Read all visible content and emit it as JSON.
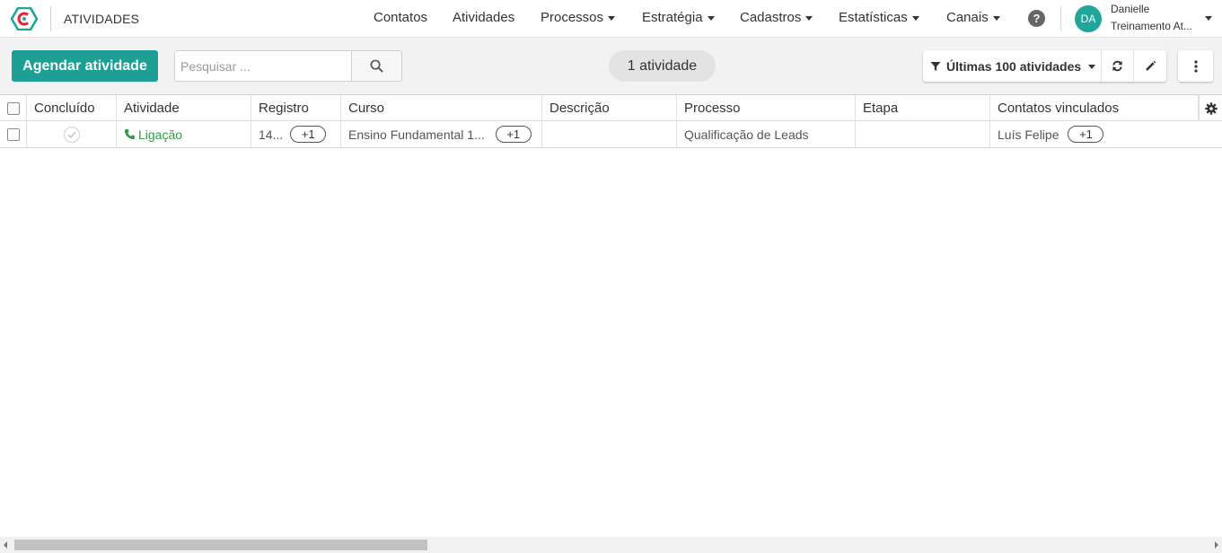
{
  "header": {
    "app_title": "ATIVIDADES",
    "logo_icon": "hexagon-logo-icon",
    "nav": [
      {
        "label": "Contatos",
        "has_dropdown": false
      },
      {
        "label": "Atividades",
        "has_dropdown": false
      },
      {
        "label": "Processos",
        "has_dropdown": true
      },
      {
        "label": "Estratégia",
        "has_dropdown": true
      },
      {
        "label": "Cadastros",
        "has_dropdown": true
      },
      {
        "label": "Estatísticas",
        "has_dropdown": true
      },
      {
        "label": "Canais",
        "has_dropdown": true
      }
    ],
    "help_icon": "?",
    "user": {
      "initials": "DA",
      "name": "Danielle",
      "org": "Treinamento At..."
    }
  },
  "toolbar": {
    "schedule_label": "Agendar atividade",
    "search_placeholder": "Pesquisar ...",
    "count_label": "1 atividade",
    "filter_label": "Últimas 100 atividades",
    "icons": [
      "filter-icon",
      "refresh-icon",
      "edit-icon",
      "more-vertical-icon"
    ]
  },
  "table": {
    "columns": [
      "Concluído",
      "Atividade",
      "Registro",
      "Curso",
      "Descrição",
      "Processo",
      "Etapa",
      "Contatos vinculados"
    ],
    "rows": [
      {
        "concluido": "",
        "atividade": "Ligação",
        "registro": "14...",
        "registro_extra": "+1",
        "curso": "Ensino Fundamental 1...",
        "curso_extra": "+1",
        "descricao": "",
        "processo": "Qualificação de Leads",
        "etapa": "",
        "contatos": "Luís Felipe",
        "contatos_extra": "+1"
      }
    ]
  },
  "colors": {
    "primary": "#1e9f96",
    "avatar": "#1fa59a",
    "activity_link": "#2e9a48",
    "logo_outer": "#1fa59a",
    "logo_inner": "#e0243a"
  }
}
